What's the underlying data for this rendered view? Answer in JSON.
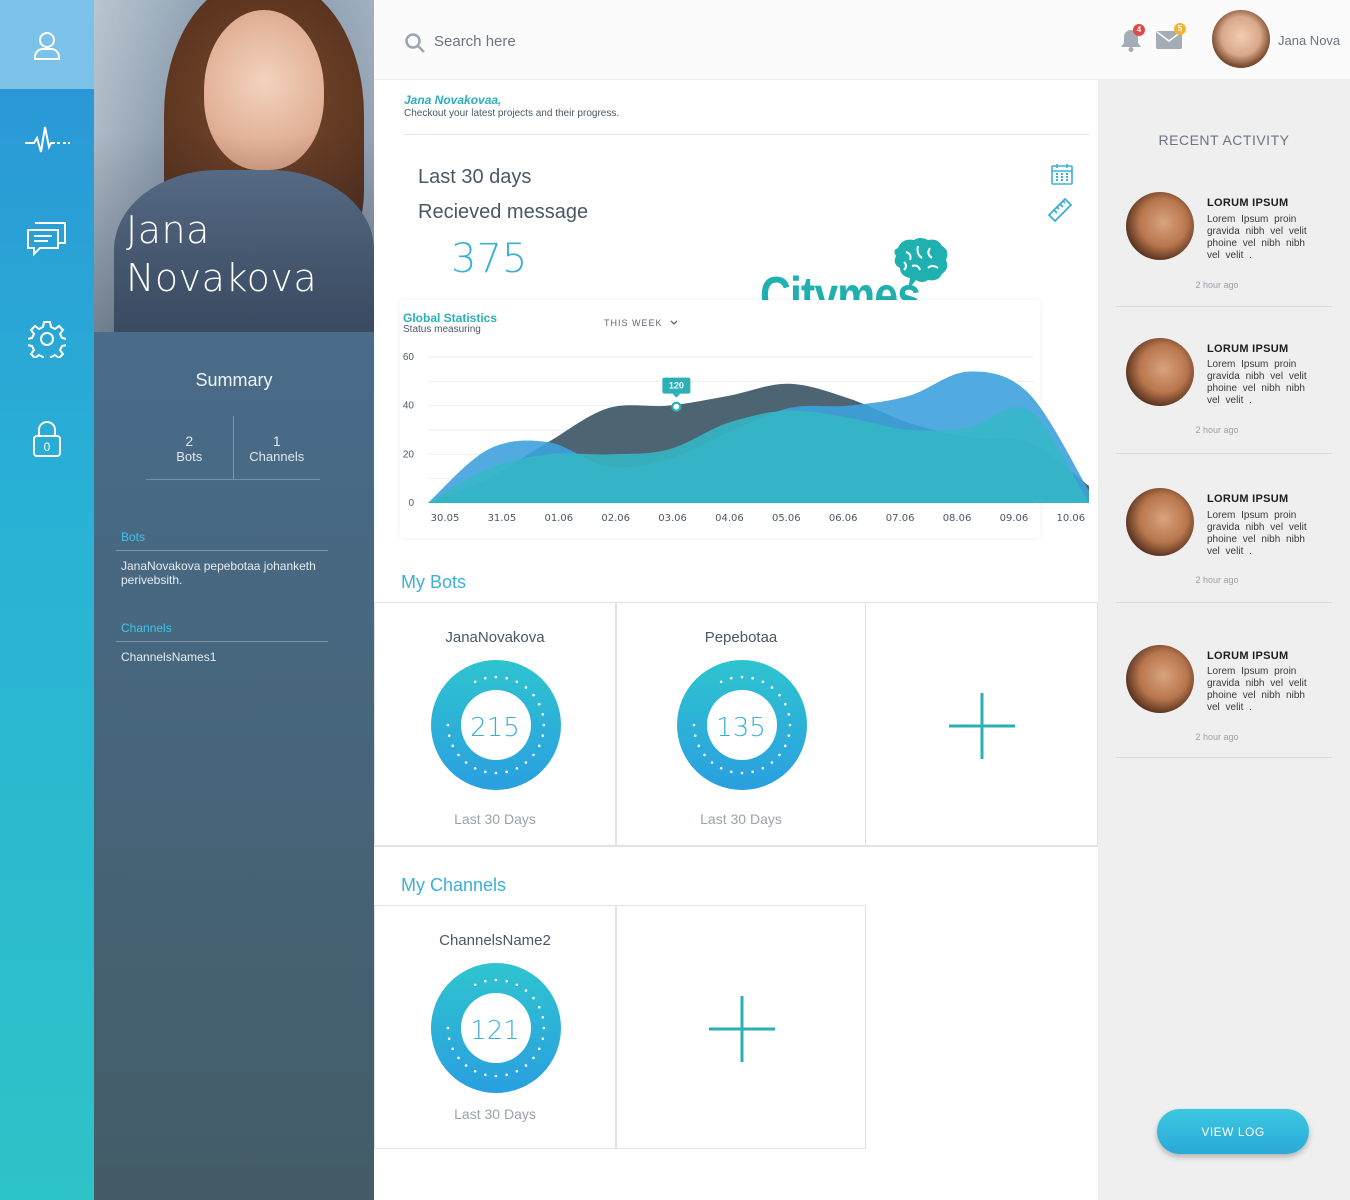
{
  "colors": {
    "accent": "#3bb0d4",
    "teal": "#2bb0b8",
    "rail_top": "#7cc1e7",
    "panel": "#47677f",
    "chart_dark": "#4d6473",
    "chart_teal": "#36b7c5",
    "chart_blue": "#3ea2dd"
  },
  "rail": {
    "items": [
      "user-icon",
      "pulse-icon",
      "chat-icon",
      "gear-icon",
      "lock-icon"
    ],
    "lock_badge": "0"
  },
  "profile": {
    "name": "Jana\nNovakova",
    "summary_title": "Summary",
    "stats": [
      {
        "value": "2",
        "label": "Bots"
      },
      {
        "value": "1",
        "label": "Channels"
      }
    ],
    "bots_label": "Bots",
    "bots_text": "JanaNovakova pepebotaa johanketh perivebsith.",
    "channels_label": "Channels",
    "channels_text": "ChannelsNames1"
  },
  "topbar": {
    "search_placeholder": "Search here",
    "notifications_count": "4",
    "messages_count": "5",
    "user_name": "Jana Nova"
  },
  "greeting": {
    "name": "Jana  Novakovaa,",
    "subtitle": "Checkout your latest projects and their progress."
  },
  "stats": {
    "period": "Last 30 days",
    "label": "Recieved message",
    "value": "375"
  },
  "brand": "Citymes",
  "chart": {
    "title": "Global Statistics",
    "subtitle": "Status measuring",
    "filter": "THIS WEEK"
  },
  "chart_data": {
    "type": "area",
    "title": "Global Statistics",
    "subtitle": "Status measuring",
    "x": [
      "30.05",
      "31.05",
      "01.06",
      "02.06",
      "03.06",
      "04.06",
      "05.06",
      "06.06",
      "07.06",
      "08.06",
      "09.06",
      "10.06"
    ],
    "yticks": [
      0,
      10,
      20,
      30,
      40,
      50,
      60
    ],
    "ytick_labels": [
      "0",
      "",
      "20",
      "",
      "40",
      "",
      "60"
    ],
    "ylim": [
      0,
      60
    ],
    "grid": true,
    "annotation": {
      "x": "03.06",
      "y": 40,
      "label": "120"
    },
    "series": [
      {
        "values": [
          0,
          10,
          25,
          39,
          40,
          44,
          49,
          43,
          33,
          27,
          25,
          7
        ]
      },
      {
        "values": [
          0,
          22,
          25,
          15,
          18,
          29,
          39,
          40,
          44,
          54,
          45,
          5
        ]
      },
      {
        "values": [
          0,
          14,
          20,
          20,
          22,
          33,
          38,
          35,
          30,
          31,
          38,
          0
        ]
      }
    ]
  },
  "my_bots": {
    "title": "My Bots",
    "items": [
      {
        "name": "JanaNovakova",
        "value": "215",
        "foot": "Last 30 Days"
      },
      {
        "name": "Pepebotaa",
        "value": "135",
        "foot": "Last 30 Days"
      }
    ]
  },
  "my_channels": {
    "title": "My Channels",
    "items": [
      {
        "name": "ChannelsName2",
        "value": "121",
        "foot": "Last 30 Days"
      }
    ]
  },
  "activity": {
    "title": "RECENT ACTIVITY",
    "items": [
      {
        "title": "LORUM IPSUM",
        "text": "Lorem Ipsum proin gravida nibh vel velit phoine vel nibh nibh vel velit .",
        "time": "2 hour ago"
      },
      {
        "title": "LORUM IPSUM",
        "text": "Lorem Ipsum proin gravida nibh vel velit phoine vel nibh nibh vel velit .",
        "time": "2 hour ago"
      },
      {
        "title": "LORUM IPSUM",
        "text": "Lorem Ipsum proin gravida nibh vel velit phoine vel nibh nibh vel velit .",
        "time": "2 hour ago"
      },
      {
        "title": "LORUM IPSUM",
        "text": "Lorem Ipsum proin gravida nibh vel velit phoine vel nibh nibh vel velit .",
        "time": "2 hour ago"
      }
    ],
    "button": "VIEW LOG"
  }
}
